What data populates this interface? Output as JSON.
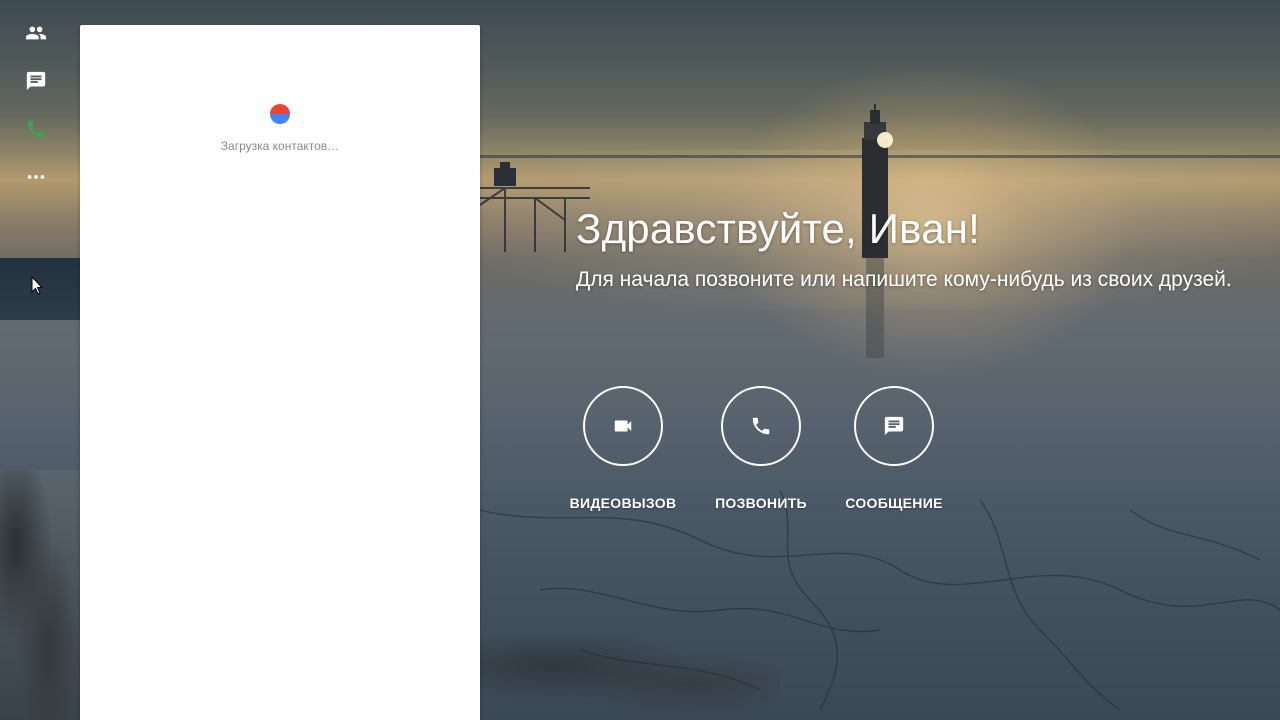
{
  "rail": {
    "items": [
      {
        "name": "contacts",
        "icon": "people-icon",
        "color": "#ffffff"
      },
      {
        "name": "messages",
        "icon": "chat-icon",
        "color": "#ffffff"
      },
      {
        "name": "calls",
        "icon": "phone-icon",
        "color": "#34a853"
      },
      {
        "name": "more",
        "icon": "more-horizontal-icon",
        "color": "#ffffff"
      }
    ]
  },
  "contacts_panel": {
    "loading_text": "Загрузка контактов…",
    "spinner_colors": [
      "#ea4335",
      "#4285f4"
    ]
  },
  "greeting": {
    "title": "Здравствуйте, Иван!",
    "subtitle": "Для начала позвоните или напишите кому-нибудь из своих друзей."
  },
  "actions": [
    {
      "label": "ВИДЕОВЫЗОВ",
      "icon": "videocam-icon"
    },
    {
      "label": "ПОЗВОНИТЬ",
      "icon": "phone-icon"
    },
    {
      "label": "СООБЩЕНИЕ",
      "icon": "message-icon"
    }
  ]
}
